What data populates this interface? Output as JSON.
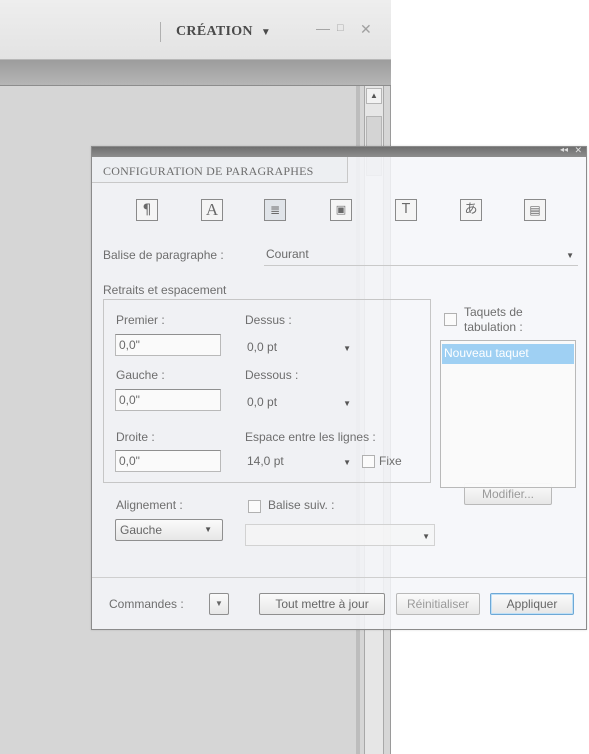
{
  "app": {
    "workspace_label": "CRÉATION",
    "window_controls": {
      "minimize": "—",
      "maximize": "□",
      "close": "✕"
    }
  },
  "palette": {
    "title": "CONFIGURATION DE PARAGRAPHES",
    "tab_icons": [
      "paragraph-icon",
      "character-icon",
      "justify-text-icon",
      "picture-frame-icon",
      "text-frame-icon",
      "japanese-text-icon",
      "table-icon"
    ],
    "para_tag": {
      "label": "Balise de paragraphe :",
      "value": "Courant"
    },
    "indents_group": {
      "label": "Retraits et espacement"
    },
    "first": {
      "label": "Premier :",
      "value": "0,0\""
    },
    "left": {
      "label": "Gauche :",
      "value": "0,0\""
    },
    "right": {
      "label": "Droite :",
      "value": "0,0\""
    },
    "above": {
      "label": "Dessus :",
      "value": "0,0 pt"
    },
    "below": {
      "label": "Dessous :",
      "value": "0,0 pt"
    },
    "leading": {
      "label": "Espace entre les lignes :",
      "value": "14,0 pt",
      "fixed_label": "Fixe"
    },
    "tab_stops": {
      "label_line1": "Taquets de",
      "label_line2": "tabulation :",
      "items": [
        "Nouveau taquet"
      ],
      "edit_button": "Modifier..."
    },
    "alignment": {
      "label": "Alignement :",
      "value": "Gauche"
    },
    "next_tag": {
      "label": "Balise suiv. :",
      "value": ""
    },
    "footer": {
      "commands_label": "Commandes :",
      "update_all": "Tout mettre à jour",
      "reset": "Réinitialiser",
      "apply": "Appliquer"
    }
  }
}
